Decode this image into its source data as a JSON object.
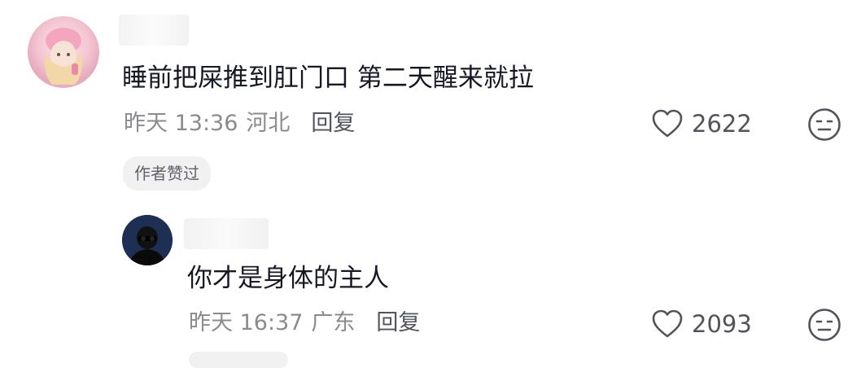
{
  "comments": [
    {
      "text": "睡前把屎推到肛门口 第二天醒来就拉",
      "time": "昨天 13:36",
      "location": "河北",
      "reply_label": "回复",
      "likes": "2622",
      "author_badge": "作者赞过"
    },
    {
      "text": "你才是身体的主人",
      "time": "昨天 16:37",
      "location": "广东",
      "reply_label": "回复",
      "likes": "2093"
    }
  ],
  "icons": {
    "like": "heart-outline-icon",
    "emoji": "neutral-face-icon"
  },
  "colors": {
    "text_primary": "#161823",
    "text_secondary": "#8a8b91",
    "badge_bg": "#f1f1f2"
  }
}
